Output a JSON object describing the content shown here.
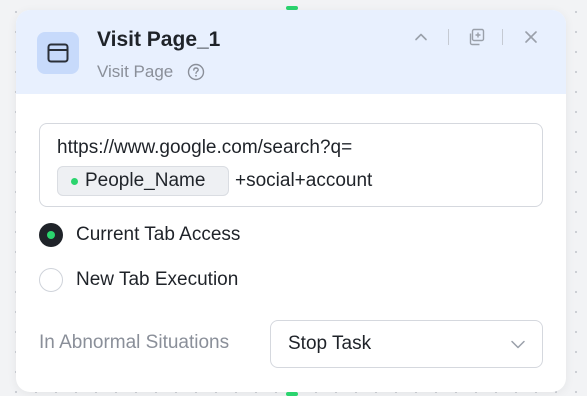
{
  "node": {
    "title": "Visit Page_1",
    "type_label": "Visit Page",
    "header_actions": [
      "collapse-icon",
      "copy-icon",
      "close-icon"
    ]
  },
  "url_field": {
    "prefix": "https://www.google.com/search?q=",
    "variable": "People_Name",
    "suffix": "+social+account"
  },
  "tab_mode": {
    "options": [
      {
        "label": "Current Tab Access",
        "selected": true
      },
      {
        "label": "New Tab Execution",
        "selected": false
      }
    ]
  },
  "abnormal": {
    "label": "In Abnormal Situations",
    "value": "Stop Task"
  },
  "colors": {
    "accent_green": "#2bd46e",
    "header_bg": "#e8f0fe",
    "icon_bg": "#c7dafb"
  }
}
